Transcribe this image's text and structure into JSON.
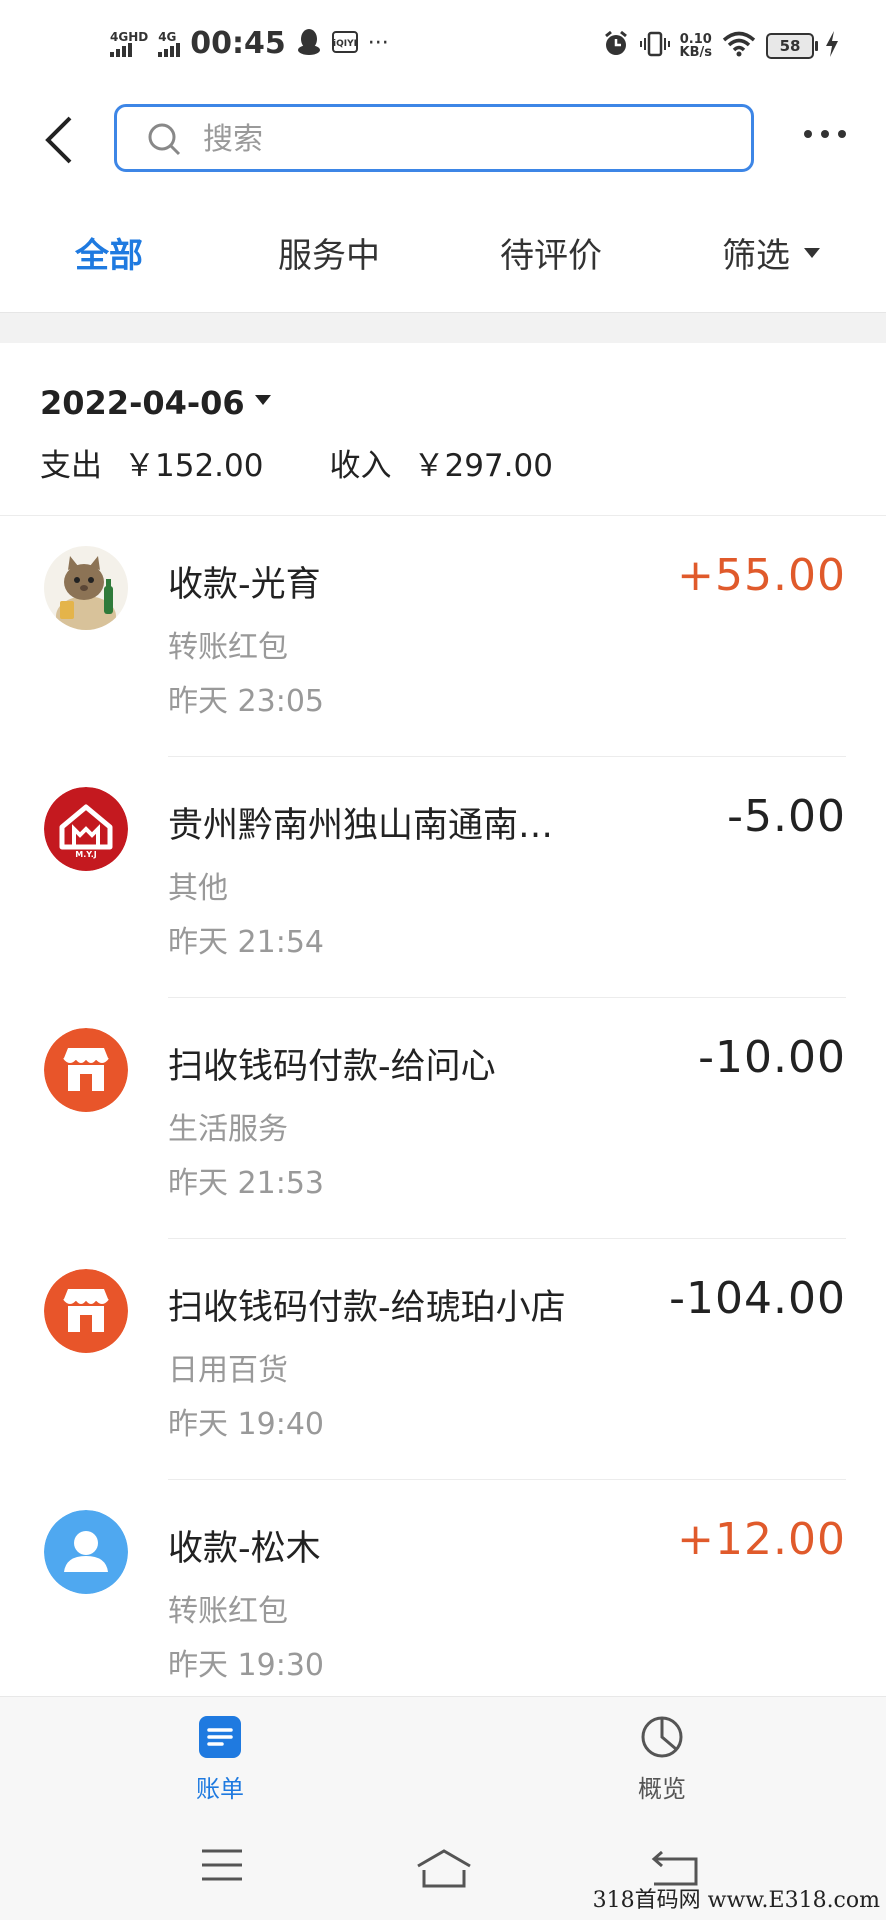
{
  "status_bar": {
    "net1": "4GHD",
    "net2": "4G",
    "time": "00:45",
    "more": "···",
    "speed_value": "0.10",
    "speed_unit": "KB/s",
    "battery": "58"
  },
  "search": {
    "placeholder": "搜索"
  },
  "tabs": [
    {
      "label": "全部",
      "active": true
    },
    {
      "label": "服务中"
    },
    {
      "label": "待评价"
    },
    {
      "label": "筛选"
    }
  ],
  "date_group": {
    "date": "2022-04-06",
    "expense_label": "支出",
    "expense_value": "￥152.00",
    "income_label": "收入",
    "income_value": "￥297.00"
  },
  "transactions": [
    {
      "title": "收款-光育",
      "category": "转账红包",
      "time": "昨天  23:05",
      "amount": "+55.00",
      "avatar": "cat-avatar"
    },
    {
      "title": "贵州黔南州独山南通南…",
      "category": "其他",
      "time": "昨天  21:54",
      "amount": "-5.00",
      "avatar": "myj-logo",
      "avatar_text": "M.Y.J"
    },
    {
      "title": "扫收钱码付款-给问心",
      "category": "生活服务",
      "time": "昨天  21:53",
      "amount": "-10.00",
      "avatar": "shop-icon"
    },
    {
      "title": "扫收钱码付款-给琥珀小店",
      "category": "日用百货",
      "time": "昨天  19:40",
      "amount": "-104.00",
      "avatar": "shop-icon"
    },
    {
      "title": "收款-松木",
      "category": "转账红包",
      "time": "昨天  19:30",
      "amount": "+12.00",
      "avatar": "user-icon"
    }
  ],
  "bottom_nav": {
    "bill": "账单",
    "overview": "概览"
  },
  "watermark": "318首码网 www.E318.com",
  "colors": {
    "accent": "#1f7ae0",
    "income": "#e05a2b",
    "shop_orange": "#e8552a",
    "myj_red": "#c4191f",
    "user_blue": "#4fa8f0"
  }
}
